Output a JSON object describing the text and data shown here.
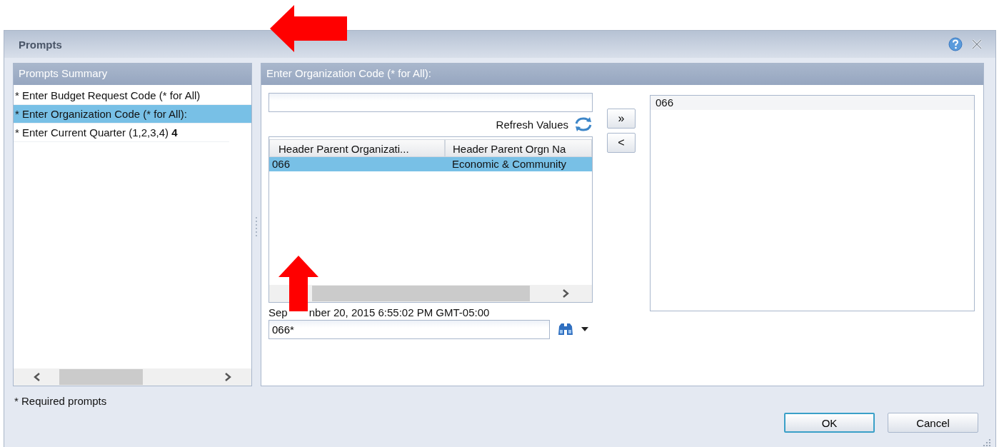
{
  "window": {
    "title": "Prompts"
  },
  "summary": {
    "title": "Prompts Summary",
    "items": [
      {
        "label": "* Enter Budget Request Code (* for All)",
        "selected": false
      },
      {
        "label": "* Enter Organization Code (* for All):",
        "selected": true
      },
      {
        "label": "* Enter Current Quarter (1,2,3,4)",
        "value": "4",
        "selected": false
      }
    ]
  },
  "prompt": {
    "title": "Enter Organization Code (* for All):",
    "refresh": "Refresh Values",
    "table": {
      "columns": [
        "Header Parent Organizati...",
        "Header Parent Orgn Na"
      ],
      "rows": [
        {
          "cells": [
            "066",
            "Economic & Community"
          ],
          "selected": true
        }
      ]
    },
    "timestamp_parts": [
      "Sep",
      "nber 20, 2015 6:55:02 PM GMT-05:00"
    ],
    "search_value": "066*",
    "move_buttons": [
      "»",
      "<"
    ],
    "selected_values": [
      "066"
    ]
  },
  "footnote": "* Required prompts",
  "buttons": [
    {
      "label": "OK",
      "focused": true
    },
    {
      "label": "Cancel",
      "focused": false
    }
  ]
}
